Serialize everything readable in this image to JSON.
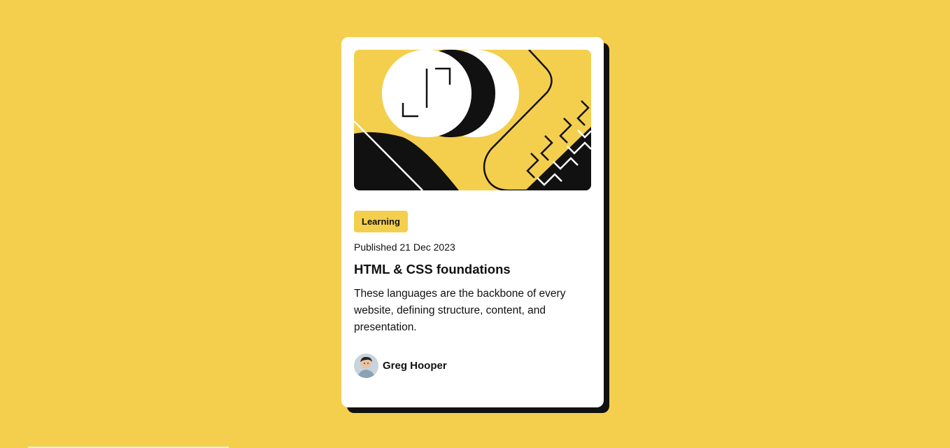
{
  "card": {
    "tag": "Learning",
    "published": "Published 21 Dec 2023",
    "title": "HTML & CSS foundations",
    "description": "These languages are the backbone of every website, defining structure, content, and presentation.",
    "author": {
      "name": "Greg Hooper"
    },
    "hero_icon": "illustration-article-icon"
  },
  "colors": {
    "background": "#F4CF4E",
    "card": "#FFFFFF",
    "text": "#111111",
    "shadow": "#111111"
  }
}
